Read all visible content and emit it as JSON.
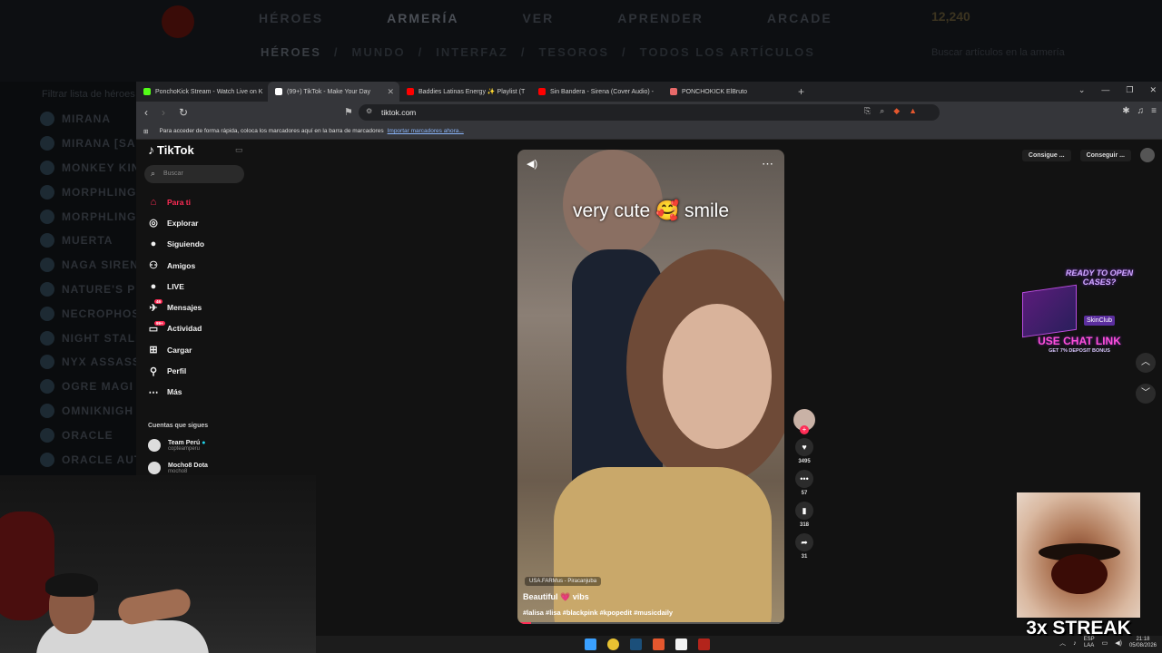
{
  "game": {
    "nav": [
      "HÉROES",
      "ARMERÍA",
      "VER",
      "APRENDER",
      "ARCADE"
    ],
    "nav_active": "ARMERÍA",
    "sub": [
      "HÉROES",
      "/",
      "MUNDO",
      "/",
      "INTERFAZ",
      "/",
      "TESOROS",
      "/",
      "TODOS LOS ARTÍCULOS"
    ],
    "gold": "12,240",
    "search_placeholder": "Buscar artículos en la armería",
    "hero_filter": "Filtrar lista de héroes",
    "heroes": [
      "MIRANA",
      "MIRANA [SA",
      "MONKEY KIN",
      "MORPHLING",
      "MORPHLING",
      "MUERTA",
      "NAGA SIREN",
      "NATURE'S PR",
      "NECROPHOS",
      "NIGHT STALI",
      "NYX ASSASS",
      "OGRE MAGI",
      "OMNIKNIGH",
      "ORACLE",
      "ORACLE AUT"
    ]
  },
  "browser": {
    "tabs": [
      {
        "label": "PonchoKick Stream - Watch Live on K",
        "color": "#53fc18"
      },
      {
        "label": "(99+) TikTok - Make Your Day",
        "color": "#ffffff"
      },
      {
        "label": "Baddies Latinas Energy ✨ Playlist (T",
        "color": "#ff0000"
      },
      {
        "label": "Sin Bandera - Sirena (Cover Audio) -",
        "color": "#ff0000"
      },
      {
        "label": "PONCHOKICK ElBruto",
        "color": "#e86a6a"
      }
    ],
    "url": "tiktok.com",
    "bookmarks_hint": "Para acceder de forma rápida, coloca los marcadores aquí en la barra de marcadores",
    "bookmarks_link": "Importar marcadores ahora..."
  },
  "tiktok": {
    "logo": "TikTok",
    "search_placeholder": "Buscar",
    "menu": [
      {
        "label": "Para ti",
        "icon": "⌂",
        "active": true
      },
      {
        "label": "Explorar",
        "icon": "◎",
        "active": false
      },
      {
        "label": "Siguiendo",
        "icon": "●",
        "active": false
      },
      {
        "label": "Amigos",
        "icon": "⚇",
        "active": false
      },
      {
        "label": "LIVE",
        "icon": "●",
        "active": false
      },
      {
        "label": "Mensajes",
        "icon": "✈",
        "active": false,
        "badge": "46"
      },
      {
        "label": "Actividad",
        "icon": "▭",
        "active": false,
        "badge": "99+"
      },
      {
        "label": "Cargar",
        "icon": "⊞",
        "active": false
      },
      {
        "label": "Perfil",
        "icon": "⚲",
        "active": false
      },
      {
        "label": "Más",
        "icon": "⋯",
        "active": false
      }
    ],
    "following_title": "Cuentas que sigues",
    "accounts": [
      {
        "name": "Team Perú",
        "handle": "copteamperu"
      },
      {
        "name": "Mocho8 Dota",
        "handle": "mocho8"
      }
    ],
    "get_buttons": [
      "Consigue ...",
      "Conseguir ..."
    ],
    "video": {
      "overlay_text": "very cute 🥰 smile",
      "location": "USA.FARMus - Piracanjuba",
      "title": "Beautiful 💗 vibs",
      "tags": "#lalisa #lisa #blackpink #kpopedit #musicdaily",
      "progress": 0.05
    },
    "actions": [
      {
        "icon": "♥",
        "count": "3495"
      },
      {
        "icon": "•••",
        "count": "57"
      },
      {
        "icon": "▮",
        "count": "318"
      },
      {
        "icon": "➦",
        "count": "31"
      }
    ]
  },
  "overlay": {
    "ad_ready": "READY TO OPEN CASES?",
    "ad_brand": "SkinClub",
    "ad_chat": "USE CHAT LINK",
    "ad_bonus": "GET 7% DEPOSIT BONUS",
    "streak": "3x STREAK"
  },
  "taskbar": {
    "lang": "ESP",
    "lang2": "LAA",
    "time": "21:18",
    "date": "05/08/2026"
  }
}
